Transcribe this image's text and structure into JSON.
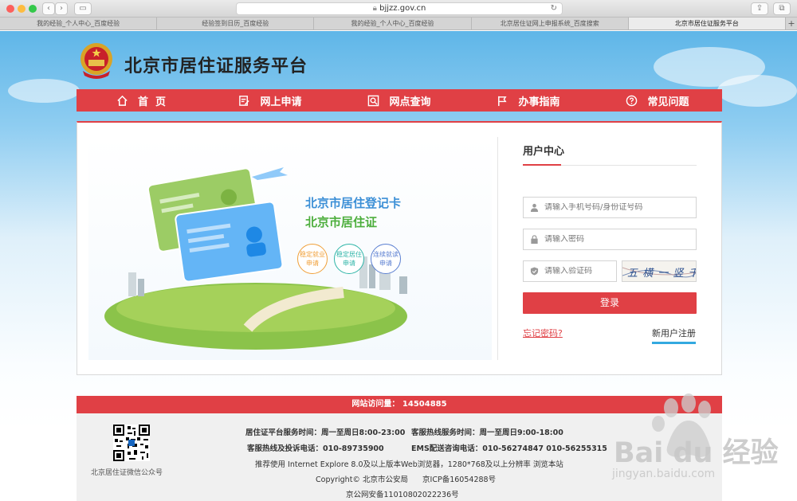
{
  "browser": {
    "url": "bjjzz.gov.cn",
    "tabs": [
      {
        "label": "我的经验_个人中心_百度经验"
      },
      {
        "label": "经验签到日历_百度经验"
      },
      {
        "label": "我的经验_个人中心_百度经验"
      },
      {
        "label": "北京居住证网上申报系统_百度搜索"
      },
      {
        "label": "北京市居住证服务平台"
      }
    ]
  },
  "site": {
    "title": "北京市居住证服务平台"
  },
  "nav": [
    {
      "label": "首  页",
      "icon": "home-icon"
    },
    {
      "label": "网上申请",
      "icon": "edit-form-icon"
    },
    {
      "label": "网点查询",
      "icon": "search-location-icon"
    },
    {
      "label": "办事指南",
      "icon": "flag-icon"
    },
    {
      "label": "常见问题",
      "icon": "question-icon"
    }
  ],
  "banner": {
    "title1": "北京市居住登记卡",
    "title2": "北京市居住证",
    "circles": [
      {
        "line1": "稳定就业",
        "line2": "申请",
        "color": "#f0a03a"
      },
      {
        "line1": "稳定居住",
        "line2": "申请",
        "color": "#2fb5a8"
      },
      {
        "line1": "连续就读",
        "line2": "申请",
        "color": "#5b7fd1"
      }
    ]
  },
  "user_center": {
    "title": "用户中心",
    "username_placeholder": "请输入手机号码/身份证号码",
    "password_placeholder": "请输入密码",
    "captcha_placeholder": "请输入验证码",
    "captcha_text": "五 横 一 竖 千 ?",
    "login_label": "登录",
    "forgot_label": "忘记密码?",
    "register_label": "新用户注册"
  },
  "footer": {
    "visits": "网站访问量： 14504885",
    "qr_label": "北京居住证微信公众号",
    "service_hours": "居住证平台服务时间：周一至周日8:00-23:00",
    "hotline_hours": "客服热线服务时间：周一至周日9:00-18:00",
    "hotline": "客服热线及投诉电话：010-89735900",
    "ems": "EMS配送咨询电话：010-56274847 010-56255315",
    "browser_note": "推荐使用 Internet Explore 8.0及以上版本Web浏览器，1280*768及以上分辨率 浏览本站",
    "copyright": "Copyright© 北京市公安局      京ICP备16054288号",
    "beian": "京公网安备11010802022236号"
  },
  "watermark": {
    "text": "Bai du 经验",
    "url": "jingyan.baidu.com"
  },
  "colors": {
    "accent": "#e04045",
    "link_underline": "#33a9e0",
    "title_blue": "#3b8fd6",
    "title_green": "#4cae3c"
  }
}
